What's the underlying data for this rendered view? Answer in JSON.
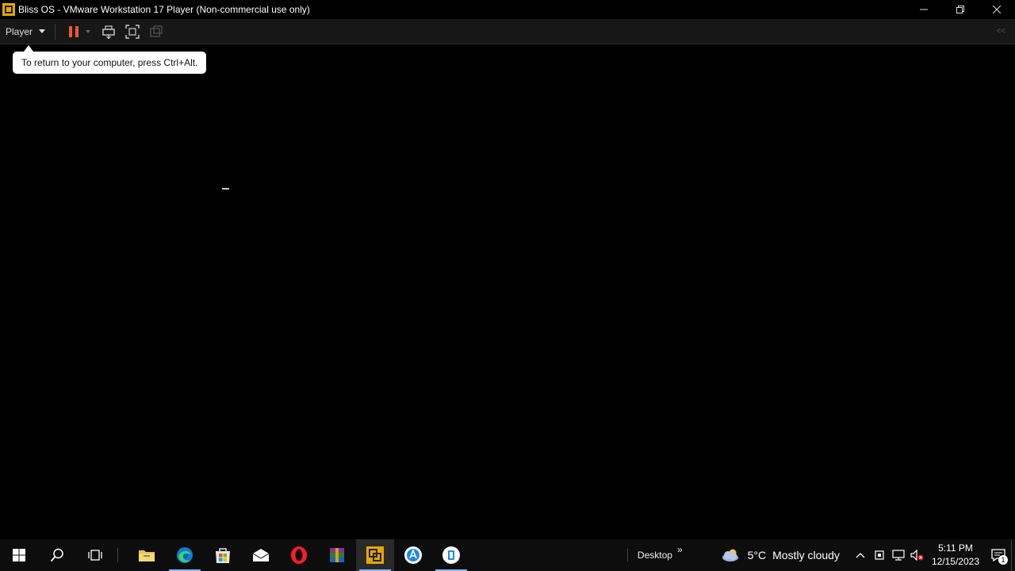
{
  "window": {
    "title": "Bliss OS - VMware Workstation 17 Player (Non-commercial use only)",
    "icon": "vmware-player-icon",
    "controls": [
      "minimize-icon",
      "restore-icon",
      "close-icon"
    ]
  },
  "toolbar": {
    "player_menu_label": "Player",
    "buttons": [
      "pause-icon",
      "send-ctrl-alt-del-icon",
      "fullscreen-icon",
      "unity-icon"
    ],
    "right_glyph": "<<"
  },
  "tooltip": {
    "text": "To return to your computer, press Ctrl+Alt."
  },
  "taskbar": {
    "apps": [
      "start-icon",
      "search-icon",
      "task-view-icon",
      "file-explorer-icon",
      "edge-icon",
      "microsoft-store-icon",
      "mail-icon",
      "opera-icon",
      "winrar-icon",
      "vmware-icon",
      "app-icon",
      "notepad-icon"
    ],
    "desktop_label": "Desktop",
    "desktop_chevron": "»",
    "weather": {
      "temperature": "5°C",
      "condition": "Mostly cloudy",
      "icon": "cloud-icon"
    },
    "tray_icons": [
      "chevron-up-icon",
      "device-icon",
      "network-icon",
      "volume-muted-icon"
    ],
    "clock": {
      "time": "5:11 PM",
      "date": "12/15/2023"
    },
    "notification_count": "1"
  },
  "colors": {
    "accent": "#8cb4ff",
    "pause": "#f05a23",
    "vmware": "#e8a700"
  }
}
